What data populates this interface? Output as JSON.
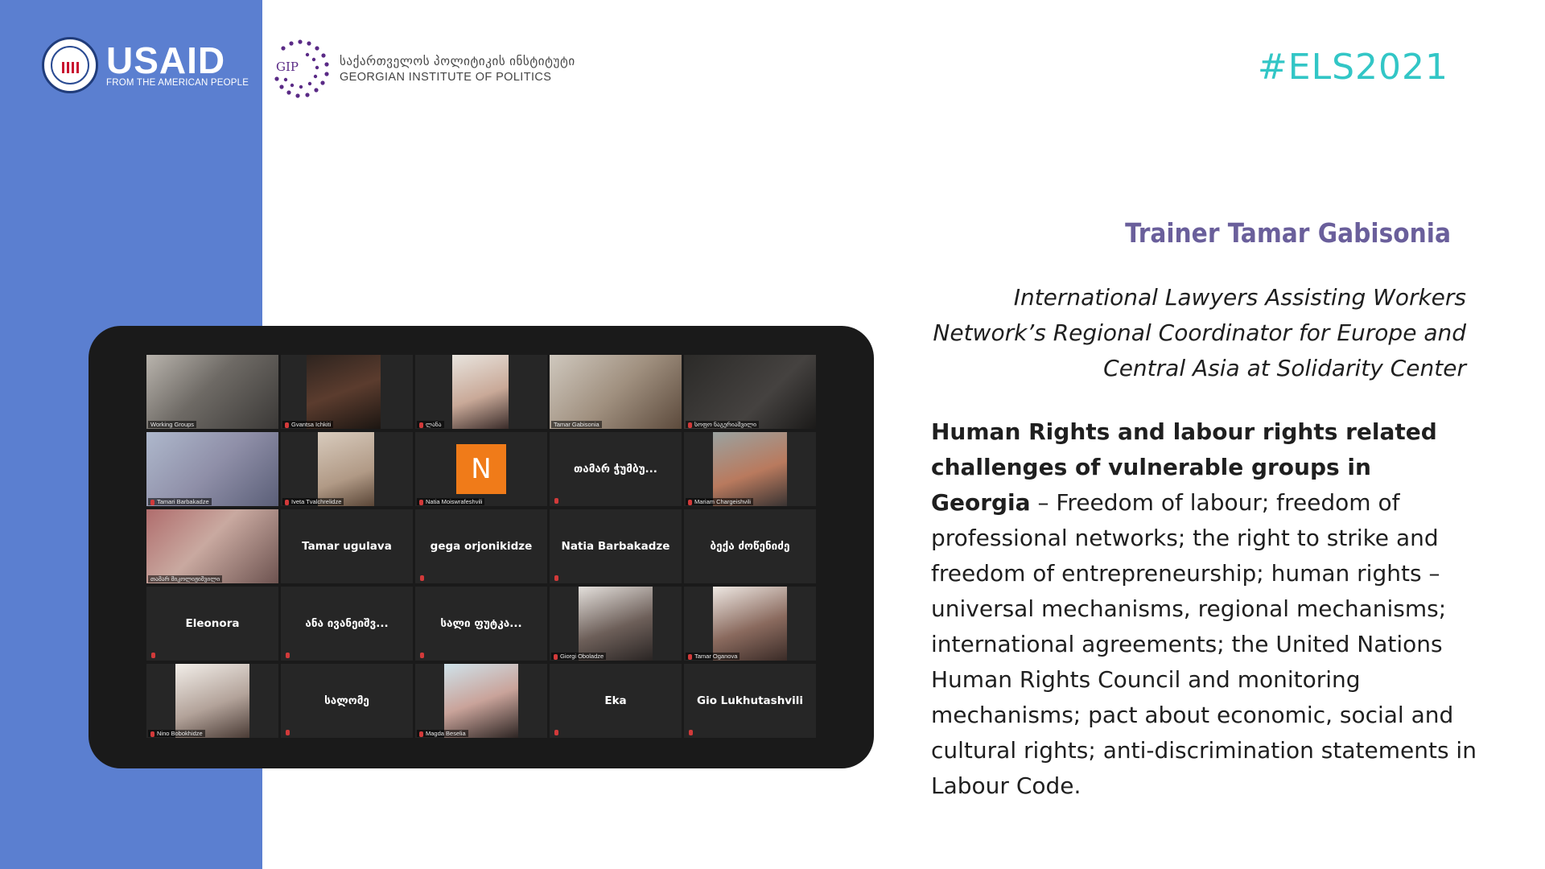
{
  "branding": {
    "usaid_word": "USAID",
    "usaid_sub": "FROM THE AMERICAN PEOPLE",
    "seal_icon": "usaid-seal-icon",
    "gip_ka": "საქართველოს პოლიტიკის ინსტიტუტი",
    "gip_en": "GEORGIAN INSTITUTE OF POLITICS",
    "gip_mark_text": "GIP",
    "hashtag": "#ELS2021",
    "colors": {
      "band": "#5b7fd0",
      "hashtag": "#32c6c6",
      "trainer": "#6a5f9b"
    }
  },
  "content": {
    "trainer": "Trainer Tamar Gabisonia",
    "role": "International Lawyers Assisting Workers Network’s Regional Coordinator for Europe and Central Asia at Solidarity Center",
    "topic_title": "Human Rights and labour rights related challenges of vulnerable groups in Georgia",
    "topic_body": " – Freedom of labour; freedom of professional networks; the right to strike and freedom of entrepreneurship; human rights – universal mechanisms, regional mechanisms; international agreements; the United Nations Human Rights Council and monitoring mechanisms; pact about economic, social and cultural rights; anti-discrimination statements in Labour Code."
  },
  "zoom": {
    "tiles": [
      {
        "label": "Working Groups",
        "center": ""
      },
      {
        "label": "Gvantsa Ichkiti",
        "center": ""
      },
      {
        "label": "ლანა",
        "center": ""
      },
      {
        "label": "Tamar Gabisonia",
        "center": ""
      },
      {
        "label": "სოფო ნაგერიაშვილი",
        "center": ""
      },
      {
        "label": "Tamari Barbakadze",
        "center": ""
      },
      {
        "label": "Iveta Tvalchrelidze",
        "center": ""
      },
      {
        "label": "Natia Moiswrafeshvili",
        "center": "",
        "avatar": "N"
      },
      {
        "label": "",
        "center": "თამარ ჭუმბუ..."
      },
      {
        "label": "Mariam Chargeishvili",
        "center": ""
      },
      {
        "label": "თამარ მიკოლიჟიშვილი",
        "center": ""
      },
      {
        "label": "",
        "center": "Tamar ugulava"
      },
      {
        "label": "",
        "center": "gega orjonikidze"
      },
      {
        "label": "",
        "center": "Natia Barbakadze"
      },
      {
        "label": "",
        "center": "ბექა ძოწენიძე"
      },
      {
        "label": "",
        "center": "Eleonora"
      },
      {
        "label": "",
        "center": "ანა ივანეიშვ..."
      },
      {
        "label": "",
        "center": "სალი ფუტკა..."
      },
      {
        "label": "Giorgi Oboladze",
        "center": ""
      },
      {
        "label": "Tamar Oganova",
        "center": ""
      },
      {
        "label": "Nino Bobokhidze",
        "center": ""
      },
      {
        "label": "",
        "center": "სალომე"
      },
      {
        "label": "Magda Beselia",
        "center": ""
      },
      {
        "label": "",
        "center": "Eka"
      },
      {
        "label": "",
        "center": "Gio Lukhutashvili"
      }
    ]
  }
}
